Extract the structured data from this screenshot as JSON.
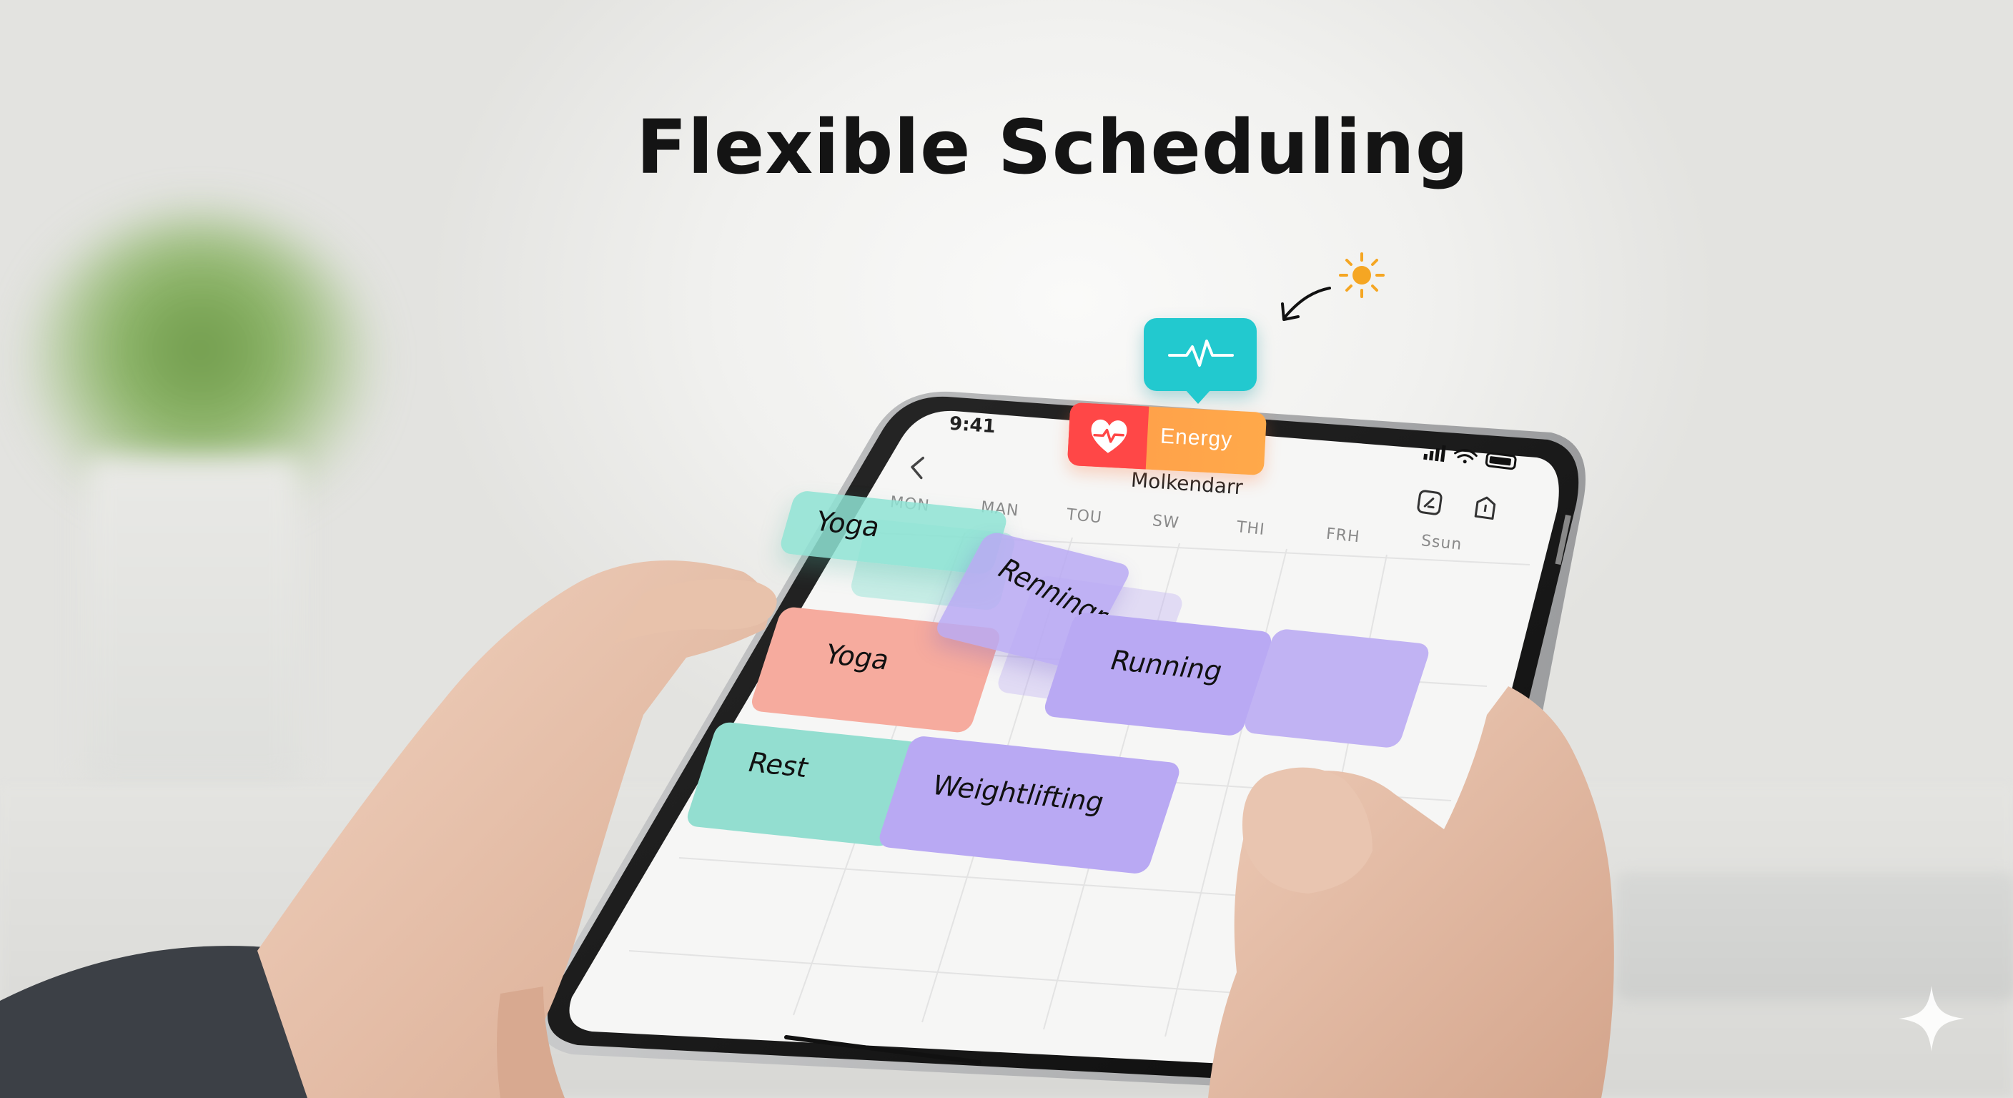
{
  "headline": "Flexible Scheduling",
  "status_bar": {
    "time": "9:41"
  },
  "energy_chip": {
    "label": "Energy",
    "icon": "heart-pulse-icon"
  },
  "floating_badge": {
    "icon": "heartbeat-icon"
  },
  "app": {
    "title": "Molkendarr",
    "back_icon": "chevron-left-icon",
    "header_icons": [
      "edit-icon",
      "share-icon"
    ]
  },
  "days": [
    "MON",
    "MAN",
    "TOU",
    "SW",
    "THI",
    "FRH",
    "Ssun"
  ],
  "events": {
    "yoga_dragged": "Yoga",
    "running_dragged": "Renningr",
    "yoga": "Yoga",
    "running": "Running",
    "rest": "Rest",
    "weightlifting": "Weightlifting",
    "empty_block": ""
  },
  "colors": {
    "teal": "#8ee3d4",
    "salmon": "#f6ab9e",
    "lavender": "#b9a9f3",
    "badge_teal": "#22c9cf",
    "energy_red": "#ff4747",
    "energy_orange": "#ffa24a",
    "sun": "#f5a623"
  },
  "decor": {
    "sun_icon": "sun-icon",
    "arrow_icon": "curved-arrow-icon",
    "sparkle_icon": "sparkle-icon"
  }
}
